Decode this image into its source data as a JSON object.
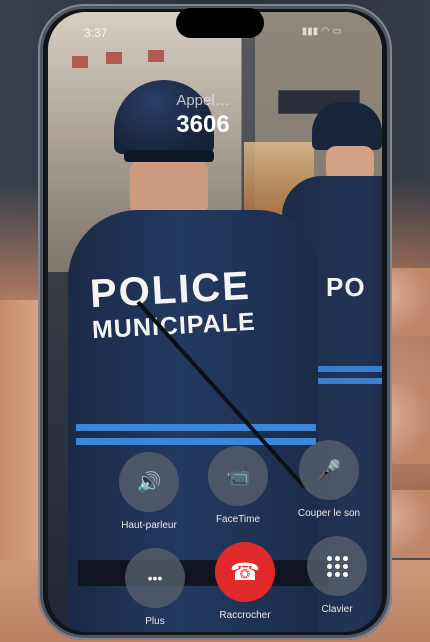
{
  "status_bar": {
    "time": "3:37"
  },
  "call": {
    "status": "Appel…",
    "number": "3606"
  },
  "photo_text": {
    "jacket_line1": "POLICE",
    "jacket_line2": "MUNICIPALE",
    "second_officer": "PO"
  },
  "controls": [
    {
      "label": "Haut-parleur",
      "icon": "speaker-icon",
      "glyph": "🔊",
      "state": "on"
    },
    {
      "label": "FaceTime",
      "icon": "video-camera-icon",
      "glyph": "📹",
      "state": "disabled"
    },
    {
      "label": "Couper le son",
      "icon": "mic-off-icon",
      "glyph": "🎤",
      "state": "off"
    },
    {
      "label": "Plus",
      "icon": "more-icon",
      "glyph": "•••",
      "state": "off"
    },
    {
      "label": "Raccrocher",
      "icon": "hang-up-icon",
      "glyph": "☎",
      "state": "danger"
    },
    {
      "label": "Clavier",
      "icon": "keypad-icon",
      "glyph": "",
      "state": "off"
    }
  ],
  "colors": {
    "hangup": "#e0292a",
    "button_bg": "#58606e",
    "stripe": "#3d86da"
  }
}
